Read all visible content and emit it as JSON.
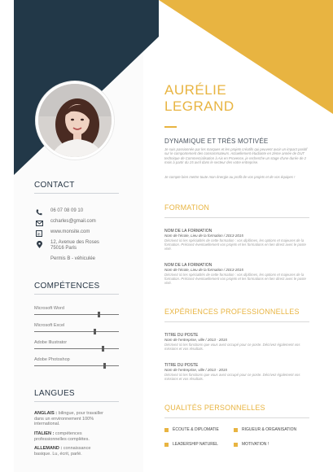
{
  "colors": {
    "navy": "#223848",
    "gold": "#e8b441",
    "sidebar": "#fbfbfb"
  },
  "header": {
    "first_name": "AURÉLIE",
    "last_name": "LEGRAND",
    "tagline": "DYNAMIQUE ET TRÈS MOTIVÉE",
    "intro_1": "Je suis passionnée par les marques et les projets créatifs qui peuvent avoir un impact positif sur le comportement des consommateurs. Actuellement étudiante en 2ème année de DUT technique de Commercialisation à Aix en Provence, je recherche un stage d'une durée de 2 mois à partir du 15 avril dans le secteur des votre entreprise.",
    "intro_2": "Je compte bien mettre toute mon énergie au profit de vos projets et de vos équipes !"
  },
  "contact": {
    "title": "CONTACT",
    "phone": "06 07 08 09 10",
    "email": "ccharles@gmail.com",
    "website": "www.monsite.com",
    "address": "12, Avenue des Roses 75016 Paris",
    "license": "Permis B - véhiculée"
  },
  "skills": {
    "title": "COMPÉTENCES",
    "items": [
      {
        "label": "Microsoft Word",
        "level": 0.75
      },
      {
        "label": "Microsoft Excel",
        "level": 0.7
      },
      {
        "label": "Adobe Illustrator",
        "level": 0.8
      },
      {
        "label": "Adobe Photoshop",
        "level": 0.82
      }
    ]
  },
  "languages": {
    "title": "LANGUES",
    "items": [
      {
        "name": "ANGLAIS :",
        "text": " bilingue, pour travailler dans un environnement 100% international."
      },
      {
        "name": "ITALIEN :",
        "text": " compétences professionnelles complètes."
      },
      {
        "name": "ALLEMAND :",
        "text": " connaissance basique. Lu, écrit, parlé."
      }
    ]
  },
  "formation": {
    "title": "FORMATION",
    "items": [
      {
        "title": "NOM DE LA FORMATION",
        "sub": "Nom de l'école, Lieu de la formation  /  2013-2015",
        "desc": "Décrivez ici les spécialités de cette formation : vos diplômes, les options et majeures de la formation. Précisez éventuellement vos projets et les formations en lien direct avec le poste visé."
      },
      {
        "title": "NOM DE LA FORMATION",
        "sub": "Nom de l'école, Lieu de la formation  /  2013-2015",
        "desc": "Décrivez ici les spécialités de cette formation : vos diplômes, les options et majeures de la formation. Précisez éventuellement vos projets et les formations en lien direct avec le poste visé."
      }
    ]
  },
  "experience": {
    "title": "EXPÉRIENCES PROFESSIONNELLES",
    "items": [
      {
        "title": "TITRE DU POSTE",
        "sub": "Nom de l'entreprise, ville  /  2013 - 2015",
        "desc": "Décrivez ici les fonctions que vous avez occupé pour ce poste. Décrivez également vos missions et vos résultats."
      },
      {
        "title": "TITRE DU POSTE",
        "sub": "Nom de l'entreprise, ville  /  2013 - 2015",
        "desc": "Décrivez ici les fonctions que vous avez occupé pour ce poste. Décrivez également vos missions et vos résultats."
      }
    ]
  },
  "qualities": {
    "title": "QUALITÉS PERSONNELLES",
    "items": [
      "ÉCOUTE & DIPLOMATIE",
      "RIGUEUR & ORGANISATION",
      "LEADERSHIP NATUREL",
      "MOTIVATION !"
    ]
  }
}
